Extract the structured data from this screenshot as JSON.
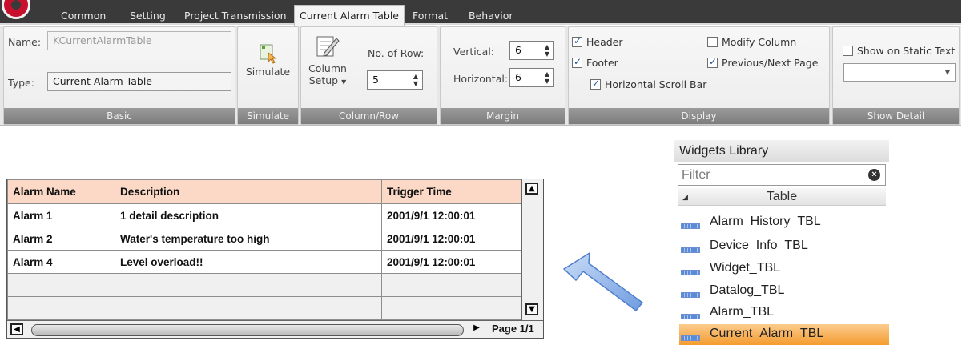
{
  "ribbon": {
    "tabs": [
      "Common",
      "Setting",
      "Project Transmission",
      "Current Alarm Table",
      "Format",
      "Behavior"
    ],
    "active_tab": "Current Alarm Table",
    "basic": {
      "name_label": "Name:",
      "name_value": "KCurrentAlarmTable",
      "type_label": "Type:",
      "type_value": "Current Alarm Table",
      "group_label": "Basic"
    },
    "simulate": {
      "button_label": "Simulate",
      "group_label": "Simulate"
    },
    "column_row": {
      "column_setup_line1": "Column",
      "column_setup_line2": "Setup",
      "rows_label": "No. of Row:",
      "rows_value": "5",
      "group_label": "Column/Row"
    },
    "margin": {
      "vertical_label": "Vertical:",
      "vertical_value": "6",
      "horizontal_label": "Horizontal:",
      "horizontal_value": "6",
      "group_label": "Margin"
    },
    "display": {
      "header_label": "Header",
      "header_checked": true,
      "footer_label": "Footer",
      "footer_checked": true,
      "hscroll_label": "Horizontal Scroll Bar",
      "hscroll_checked": true,
      "modify_label": "Modify Column",
      "modify_checked": false,
      "prevnext_label": "Previous/Next Page",
      "prevnext_checked": true,
      "group_label": "Display"
    },
    "show_detail": {
      "static_text_label": "Show on Static Text",
      "static_text_checked": false,
      "dropdown_value": "",
      "group_label": "Show Detail"
    }
  },
  "table": {
    "headers": [
      "Alarm Name",
      "Description",
      "Trigger Time"
    ],
    "rows": [
      [
        "Alarm 1",
        "1 detail description",
        "2001/9/1 12:00:01"
      ],
      [
        "Alarm 2",
        "Water's temperature too high",
        "2001/9/1 12:00:01"
      ],
      [
        "Alarm 4",
        "Level overload!!",
        "2001/9/1 12:00:01"
      ],
      [
        "",
        "",
        ""
      ],
      [
        "",
        "",
        ""
      ]
    ],
    "page_label": "Page 1/1"
  },
  "library": {
    "title": "Widgets Library",
    "filter_placeholder": "Filter",
    "category": "Table",
    "items": [
      "Alarm_History_TBL",
      "Device_Info_TBL",
      "Widget_TBL",
      "Datalog_TBL",
      "Alarm_TBL",
      "Current_Alarm_TBL"
    ],
    "selected_item": "Current_Alarm_TBL"
  },
  "colors": {
    "header_bg": "#fbd9c6",
    "selected_item": "#f49b2e",
    "arrow": "#6f9ce0"
  }
}
